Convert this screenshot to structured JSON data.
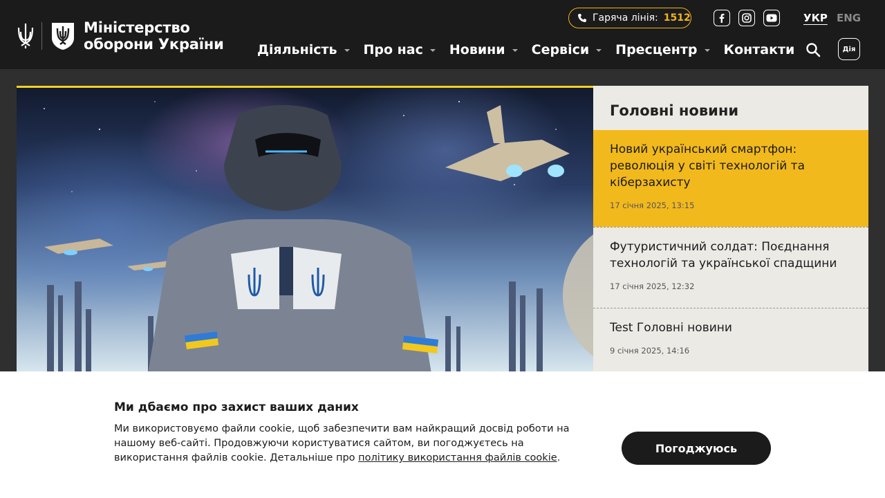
{
  "header": {
    "logo_line1": "Міністерство",
    "logo_line2": "оборони України",
    "hotline_label": "Гаряча лінія:",
    "hotline_number": "1512",
    "social": [
      "facebook-icon",
      "instagram-icon",
      "youtube-icon"
    ],
    "lang_active": "УКР",
    "lang_inactive": "ENG",
    "nav": [
      {
        "label": "Діяльність",
        "dropdown": true
      },
      {
        "label": "Про нас",
        "dropdown": true
      },
      {
        "label": "Новини",
        "dropdown": true
      },
      {
        "label": "Сервіси",
        "dropdown": true
      },
      {
        "label": "Пресцентр",
        "dropdown": true
      },
      {
        "label": "Контакти",
        "dropdown": false
      }
    ],
    "diia_label": "Дія"
  },
  "news": {
    "heading": "Головні новини",
    "items": [
      {
        "title": "Новий український смартфон: революція у світі технологій та кіберзахисту",
        "date": "17 січня 2025, 13:15"
      },
      {
        "title": "Футуристичний солдат: Поєднання технологій та української спадщини",
        "date": "17 січня 2025, 12:32"
      },
      {
        "title": "Test Головні новини",
        "date": "9 січня 2025, 14:16"
      }
    ]
  },
  "cookie": {
    "title": "Ми дбаємо про захист ваших даних",
    "text": "Ми використовуємо файли cookie, щоб забезпечити вам найкращий досвід роботи на нашому веб-сайті. Продовжуючи користуватися сайтом, ви погоджуєтесь на використання файлів cookie. Детальніше про ",
    "link": "політику використання файлів cookie",
    "end": ".",
    "accept_label": "Погоджуюсь"
  },
  "colors": {
    "accent": "#f2b91d",
    "header_bg": "#1b1b1b",
    "panel_bg": "#eceae5"
  }
}
